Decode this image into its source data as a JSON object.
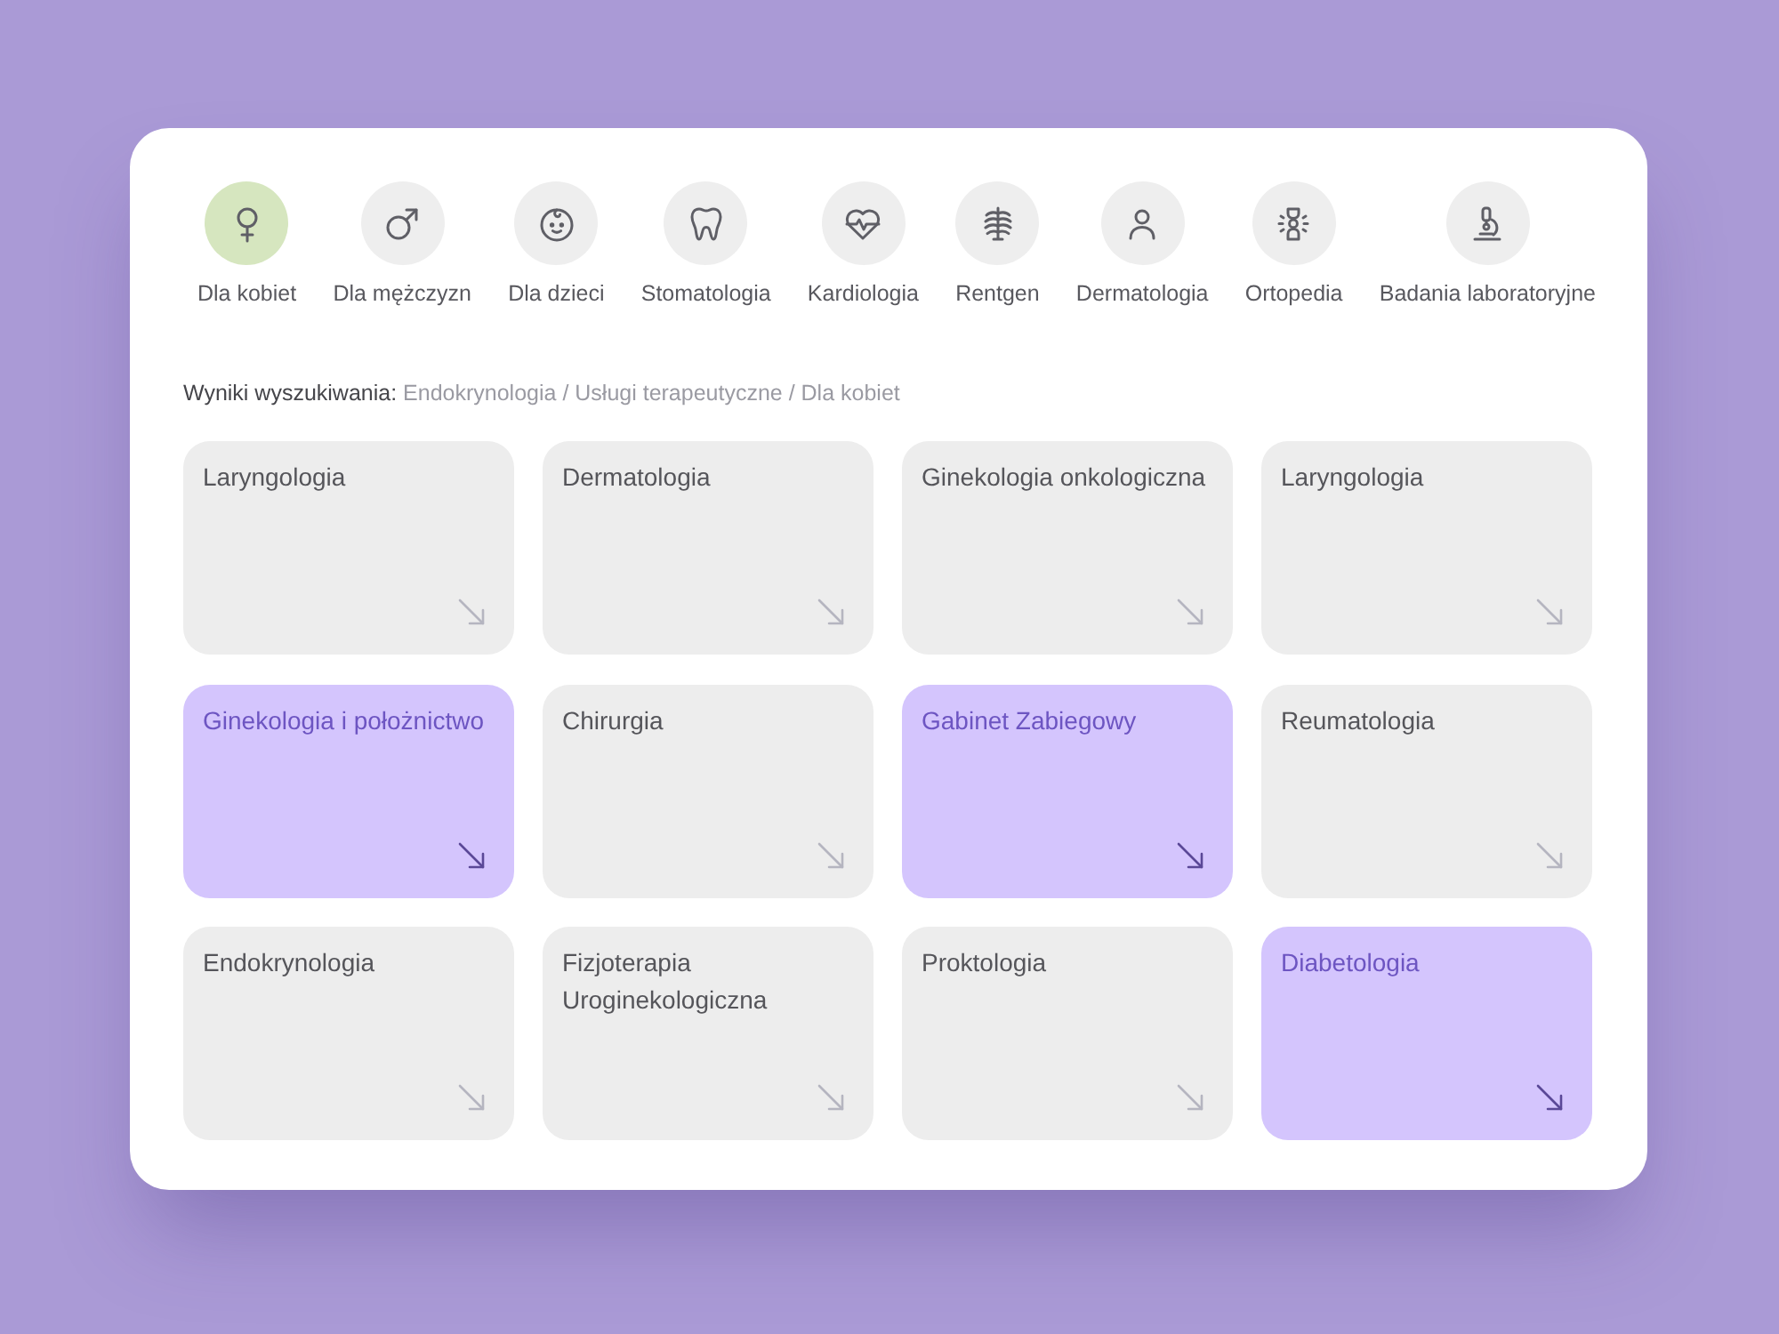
{
  "categories": [
    {
      "label": "Dla kobiet",
      "selected": true
    },
    {
      "label": "Dla mężczyzn",
      "selected": false
    },
    {
      "label": "Dla dzieci",
      "selected": false
    },
    {
      "label": "Stomatologia",
      "selected": false
    },
    {
      "label": "Kardiologia",
      "selected": false
    },
    {
      "label": "Rentgen",
      "selected": false
    },
    {
      "label": "Dermatologia",
      "selected": false
    },
    {
      "label": "Ortopedia",
      "selected": false
    },
    {
      "label": "Badania laboratoryjne",
      "selected": false
    }
  ],
  "breadcrumb": {
    "label": "Wyniki wyszukiwania:",
    "path": "Endokrynologia / Usługi terapeutyczne / Dla kobiet"
  },
  "results": [
    {
      "title": "Laryngologia",
      "selected": false
    },
    {
      "title": "Dermatologia",
      "selected": false
    },
    {
      "title": "Ginekologia onkologiczna",
      "selected": false
    },
    {
      "title": "Laryngologia",
      "selected": false
    },
    {
      "title": "Ginekologia i położnictwo",
      "selected": true
    },
    {
      "title": "Chirurgia",
      "selected": false
    },
    {
      "title": "Gabinet Zabiegowy",
      "selected": true
    },
    {
      "title": "Reumatologia",
      "selected": false
    },
    {
      "title": "Endokrynologia",
      "selected": false
    },
    {
      "title": "Fizjoterapia Uroginekologiczna",
      "selected": false
    },
    {
      "title": "Proktologia",
      "selected": false
    },
    {
      "title": "Diabetologia",
      "selected": true
    }
  ]
}
